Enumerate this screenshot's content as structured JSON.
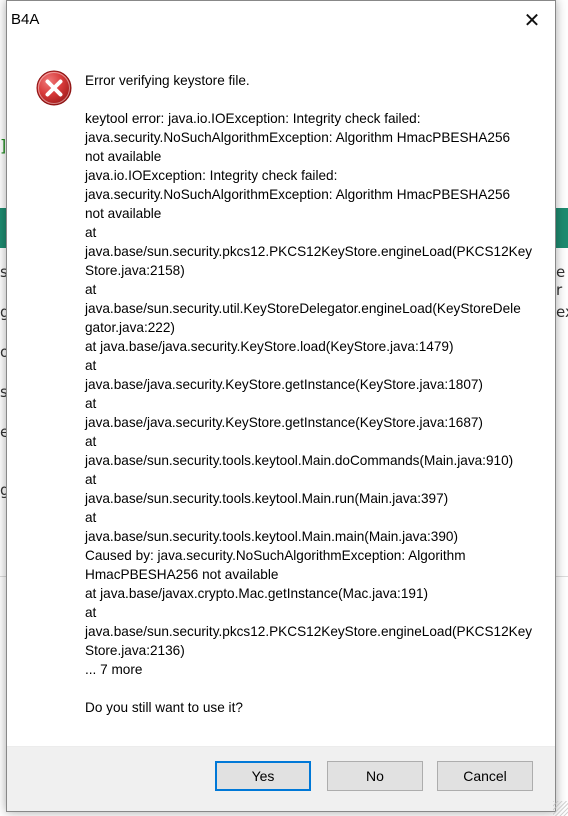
{
  "dialog": {
    "title": "B4A",
    "close_icon": "close-icon",
    "message_title": "Error verifying keystore file.",
    "message_body": "keytool error: java.io.IOException: Integrity check failed:\njava.security.NoSuchAlgorithmException: Algorithm HmacPBESHA256\nnot available\njava.io.IOException: Integrity check failed:\njava.security.NoSuchAlgorithmException: Algorithm HmacPBESHA256\nnot available\n                at\njava.base/sun.security.pkcs12.PKCS12KeyStore.engineLoad(PKCS12Key\nStore.java:2158)\n                at\njava.base/sun.security.util.KeyStoreDelegator.engineLoad(KeyStoreDele\ngator.java:222)\n                at java.base/java.security.KeyStore.load(KeyStore.java:1479)\n                at\njava.base/java.security.KeyStore.getInstance(KeyStore.java:1807)\n                at\njava.base/java.security.KeyStore.getInstance(KeyStore.java:1687)\n                at\njava.base/sun.security.tools.keytool.Main.doCommands(Main.java:910)\n                at\njava.base/sun.security.tools.keytool.Main.run(Main.java:397)\n                at\njava.base/sun.security.tools.keytool.Main.main(Main.java:390)\nCaused by: java.security.NoSuchAlgorithmException: Algorithm\nHmacPBESHA256 not available\n                at java.base/javax.crypto.Mac.getInstance(Mac.java:191)\n                at\njava.base/sun.security.pkcs12.PKCS12KeyStore.engineLoad(PKCS12Key\nStore.java:2136)\n                ... 7 more",
    "question": "Do you still want to use it?",
    "buttons": {
      "yes": "Yes",
      "no": "No",
      "cancel": "Cancel"
    }
  },
  "background": {
    "bracket": "]",
    "fragments": [
      "s",
      "g",
      "ou",
      "s",
      "e",
      "g",
      "e r",
      "ex"
    ]
  },
  "colors": {
    "error_red": "#d83b3b",
    "accent_blue": "#0078d7",
    "band_green": "#1e8b70"
  }
}
